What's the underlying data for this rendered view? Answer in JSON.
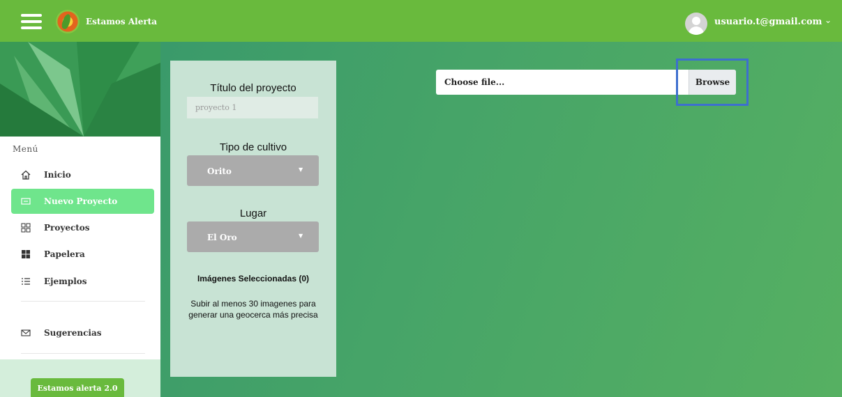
{
  "header": {
    "app_title": "Estamos Alerta",
    "user_email": "usuario.t@gmail.com",
    "user_chevron": "⌄"
  },
  "sidebar": {
    "menu_label": "Menú",
    "items": [
      {
        "label": "Inicio",
        "icon": "home-icon"
      },
      {
        "label": "Nuevo Proyecto",
        "icon": "new-project-icon",
        "active": true
      },
      {
        "label": "Proyectos",
        "icon": "grid-outline-icon"
      },
      {
        "label": "Papelera",
        "icon": "grid-filled-icon"
      },
      {
        "label": "Ejemplos",
        "icon": "list-icon"
      },
      {
        "label": "Sugerencias",
        "icon": "mail-icon"
      }
    ],
    "footer_button": "Estamos alerta 2.0"
  },
  "form": {
    "title_label": "Título del proyecto",
    "title_placeholder": "proyecto 1",
    "crop_label": "Tipo de cultivo",
    "crop_value": "Orito",
    "place_label": "Lugar",
    "place_value": "El Oro",
    "selected_heading": "Imágenes Seleccionadas (0)",
    "help_text": "Subir al menos 30 imagenes para generar una geocerca más precisa"
  },
  "upload": {
    "file_placeholder": "Choose file...",
    "browse_label": "Browse"
  },
  "colors": {
    "topbar": "#69ba3d",
    "active_nav": "#6fe58c",
    "panel": "#c8e3d4",
    "highlight": "#3d6fcf"
  }
}
